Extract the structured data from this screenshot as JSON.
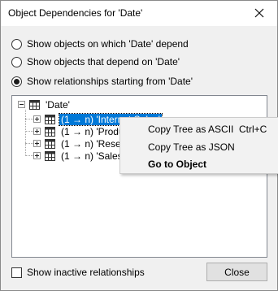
{
  "window": {
    "title": "Object Dependencies for 'Date'",
    "close_icon": "close-icon"
  },
  "options": {
    "radios": [
      {
        "label": "Show objects on which 'Date' depend",
        "checked": false
      },
      {
        "label": "Show objects that depend on 'Date'",
        "checked": false
      },
      {
        "label": "Show relationships starting from 'Date'",
        "checked": true
      }
    ]
  },
  "tree": {
    "root": {
      "label": "'Date'",
      "icon": "table-icon",
      "expanded": true
    },
    "children": [
      {
        "label": "(1 → n) 'Internet Sales'",
        "icon": "table-icon",
        "selected": true
      },
      {
        "label": "(1 → n) 'Produ",
        "icon": "table-icon",
        "selected": false
      },
      {
        "label": "(1 → n) 'Resell",
        "icon": "table-icon",
        "selected": false
      },
      {
        "label": "(1 → n) 'Sales",
        "icon": "table-icon",
        "selected": false
      }
    ]
  },
  "context_menu": {
    "items": [
      {
        "label": "Copy Tree as ASCII",
        "shortcut": "Ctrl+C",
        "bold": false
      },
      {
        "label": "Copy Tree as JSON",
        "shortcut": "",
        "bold": false
      },
      {
        "label": "Go to Object",
        "shortcut": "",
        "bold": true
      }
    ]
  },
  "footer": {
    "inactive_checkbox_label": "Show inactive relationships",
    "inactive_checked": false,
    "close_button_label": "Close"
  },
  "colors": {
    "selection": "#0078d7",
    "dialog_bg": "#f0f0f0",
    "menu_bg": "#f2f2f2"
  }
}
